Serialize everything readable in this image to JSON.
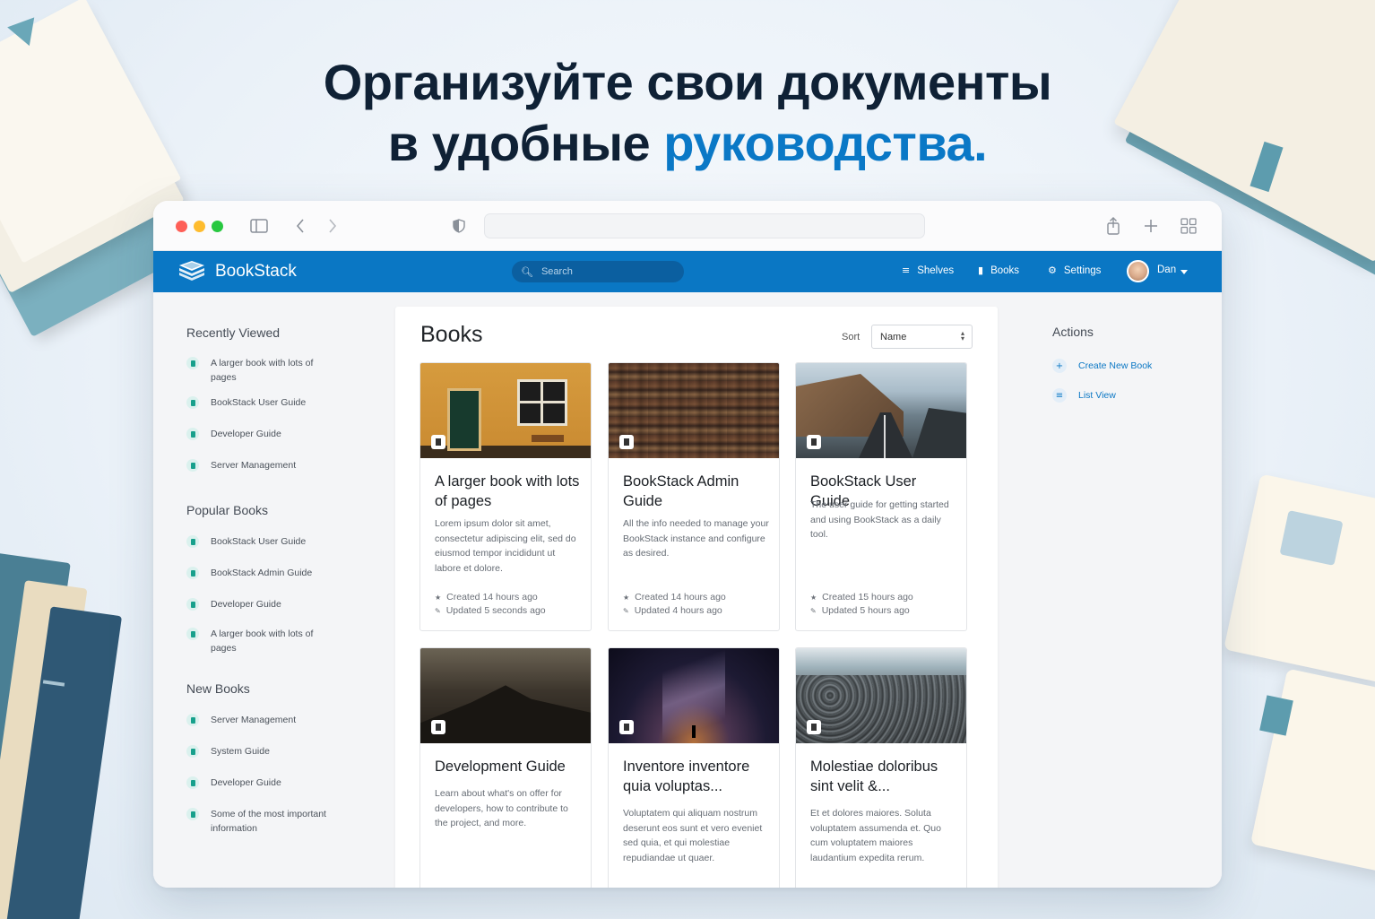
{
  "headline": {
    "line1": "Организуйте свои документы",
    "line2_prefix": "в удобные ",
    "line2_accent": "руководства."
  },
  "colors": {
    "brand_blue": "#0a77c4",
    "accent": "#0a78c6",
    "headline_text": "#0f2135",
    "book_icon": "#17a08c"
  },
  "app": {
    "brand": "BookStack",
    "search_placeholder": "Search",
    "nav": {
      "shelves": "Shelves",
      "books": "Books",
      "settings": "Settings",
      "user": "Dan"
    }
  },
  "sidebar": {
    "recently_viewed_title": "Recently Viewed",
    "recently_viewed": [
      "A larger book with lots of pages",
      "BookStack User Guide",
      "Developer Guide",
      "Server Management"
    ],
    "popular_title": "Popular Books",
    "popular": [
      "BookStack User Guide",
      "BookStack Admin Guide",
      "Developer Guide",
      "A larger book with lots of pages"
    ],
    "new_title": "New Books",
    "new_books": [
      "Server Management",
      "System Guide",
      "Developer Guide",
      "Some of the most important information"
    ]
  },
  "main": {
    "title": "Books",
    "sort_label": "Sort",
    "sort_value": "Name"
  },
  "books": [
    {
      "title": "A larger book with lots of pages",
      "description": "Lorem ipsum dolor sit amet, consectetur adipiscing elit, sed do eiusmod tempor incididunt ut labore et dolore.",
      "created": "Created 14 hours ago",
      "updated": "Updated 5 seconds ago"
    },
    {
      "title": "BookStack Admin Guide",
      "description": "All the info needed to manage your BookStack instance and configure as desired.",
      "created": "Created 14 hours ago",
      "updated": "Updated 4 hours ago"
    },
    {
      "title": "BookStack User Guide",
      "description": "The user guide for getting started and using BookStack as a daily tool.",
      "created": "Created 15 hours ago",
      "updated": "Updated 5 hours ago"
    },
    {
      "title": "Development Guide",
      "description": "Learn about what's on offer for developers, how to contribute to the project, and more."
    },
    {
      "title": "Inventore inventore quia voluptas...",
      "description": "Voluptatem qui aliquam nostrum deserunt eos sunt et vero eveniet sed quia, et qui molestiae repudiandae ut quaer."
    },
    {
      "title": "Molestiae doloribus sint velit &...",
      "description": "Et et dolores maiores. Soluta voluptatem assumenda et. Quo cum voluptatem maiores laudantium expedita rerum."
    }
  ],
  "actions": {
    "title": "Actions",
    "create": "Create New Book",
    "list_view": "List View"
  }
}
